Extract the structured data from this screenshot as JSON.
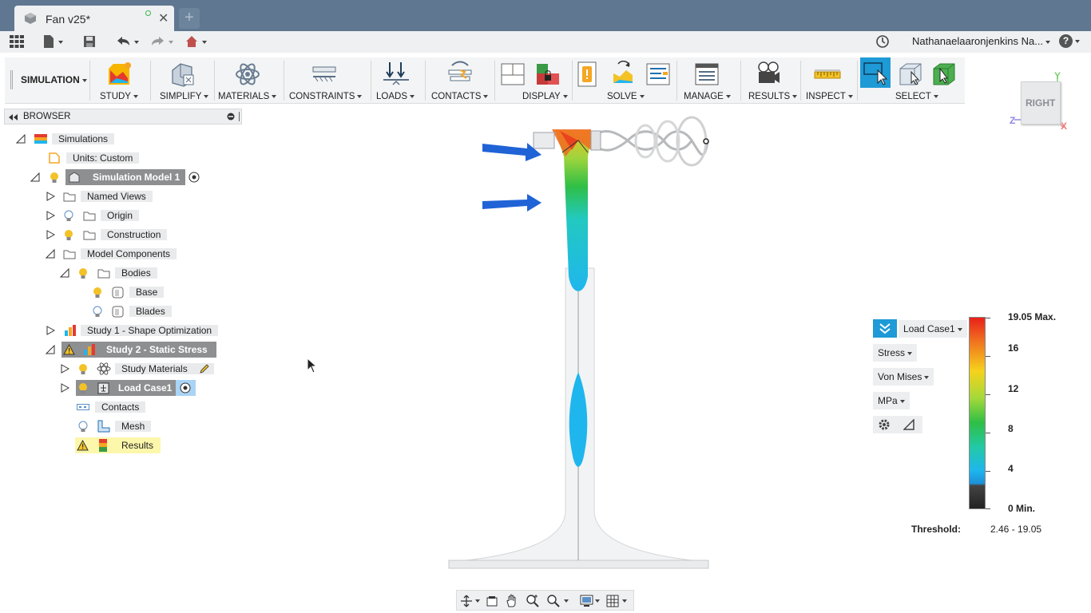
{
  "window": {
    "tab_title": "Fan v25*",
    "new_tab": "+"
  },
  "quickbar": {
    "user_name": "Nathanaelaaronjenkins Na...",
    "help": "?"
  },
  "ribbon": {
    "mode": "SIMULATION",
    "groups": [
      "STUDY",
      "SIMPLIFY",
      "MATERIALS",
      "CONSTRAINTS",
      "LOADS",
      "CONTACTS",
      "DISPLAY",
      "SOLVE",
      "MANAGE",
      "RESULTS",
      "INSPECT",
      "SELECT"
    ]
  },
  "viewcube": {
    "face": "RIGHT",
    "axis_z": "Z",
    "axis_y": "Y",
    "axis_x": "X"
  },
  "browser": {
    "title": "BROWSER",
    "items": [
      {
        "label": "Simulations"
      },
      {
        "label": "Units: Custom"
      },
      {
        "label": "Simulation Model 1"
      },
      {
        "label": "Named Views"
      },
      {
        "label": "Origin"
      },
      {
        "label": "Construction"
      },
      {
        "label": "Model Components"
      },
      {
        "label": "Bodies"
      },
      {
        "label": "Base"
      },
      {
        "label": "Blades"
      },
      {
        "label": "Study 1 - Shape Optimization"
      },
      {
        "label": "Study 2 - Static Stress"
      },
      {
        "label": "Study Materials"
      },
      {
        "label": "Load Case1"
      },
      {
        "label": "Contacts"
      },
      {
        "label": "Mesh"
      },
      {
        "label": "Results"
      }
    ]
  },
  "legend": {
    "load_case": "Load Case1",
    "result_type": "Stress",
    "component": "Von Mises",
    "unit": "MPa",
    "ticks": [
      "19.05 Max.",
      "16",
      "12",
      "8",
      "4",
      "0 Min."
    ],
    "threshold_label": "Threshold:",
    "threshold_value": "2.46 - 19.05",
    "colors": {
      "max": "#e8201a",
      "mid": "#2fbf46",
      "min": "#1fb6ee"
    }
  },
  "accent_color": "#1e9ad6"
}
